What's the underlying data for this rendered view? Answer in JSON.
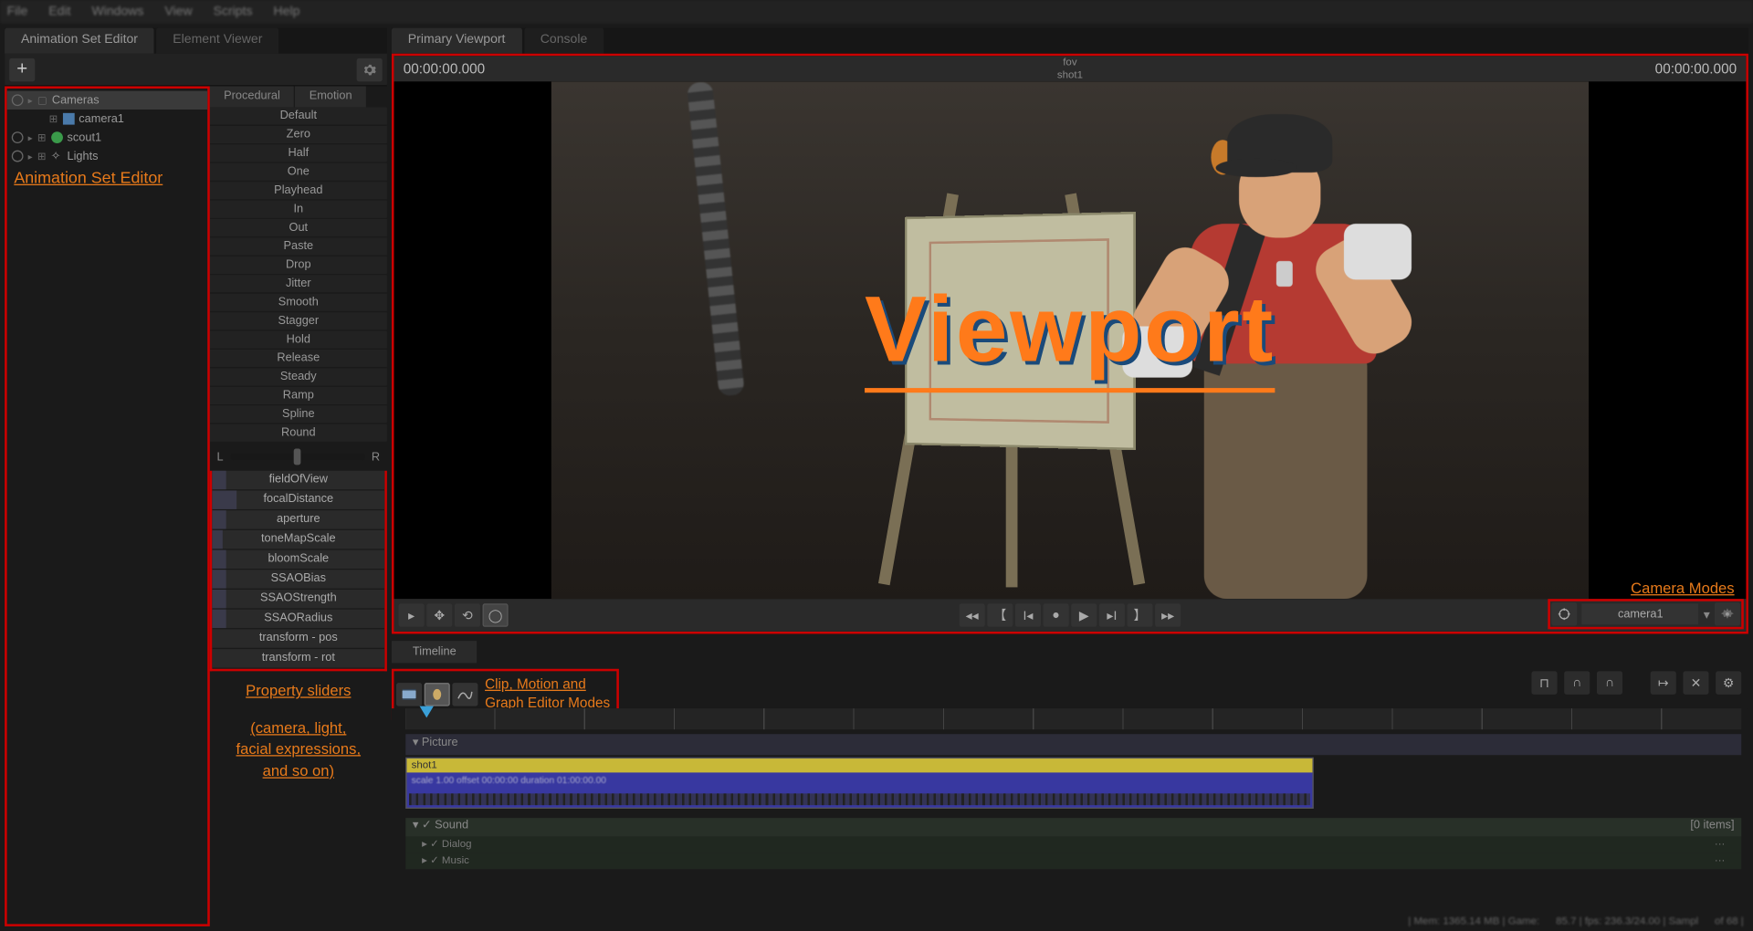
{
  "menu": [
    "File",
    "Edit",
    "Windows",
    "View",
    "Scripts",
    "Help"
  ],
  "leftTabs": {
    "a": "Animation Set Editor",
    "b": "Element Viewer"
  },
  "tree": {
    "cameras": "Cameras",
    "camera1": "camera1",
    "scout1": "scout1",
    "lights": "Lights"
  },
  "annotations": {
    "animset": "Animation Set Editor",
    "propsliders": "Property sliders",
    "propsliders2": "(camera, light,\nfacial expressions,\nand so on)",
    "viewport": "Viewport",
    "cameramodes": "Camera Modes",
    "editormodes1": "Clip, Motion and",
    "editormodes2": "Graph Editor Modes"
  },
  "propTabs": {
    "a": "Procedural",
    "b": "Emotion"
  },
  "presets": [
    "Default",
    "Zero",
    "Half",
    "One",
    "Playhead",
    "In",
    "Out",
    "Paste",
    "Drop",
    "Jitter",
    "Smooth",
    "Stagger",
    "Hold",
    "Release",
    "Steady",
    "Ramp",
    "Spline",
    "Round"
  ],
  "lr": {
    "l": "L",
    "r": "R"
  },
  "sliders": [
    "fieldOfView",
    "focalDistance",
    "aperture",
    "toneMapScale",
    "bloomScale",
    "SSAOBias",
    "SSAOStrength",
    "SSAORadius",
    "transform - pos",
    "transform - rot"
  ],
  "mainTabs": {
    "a": "Primary Viewport",
    "b": "Console"
  },
  "viewport": {
    "tcLeft": "00:00:00.000",
    "tcRight": "00:00:00.000",
    "topA": "fov",
    "topB": "shot1",
    "cameraSel": "camera1"
  },
  "timelineTab": "Timeline",
  "tracks": {
    "picture": "Picture",
    "shotName": "shot1",
    "shotMeta": "scale 1.00  offset  00:00:00  duration  01:00:00.00",
    "sound": "Sound",
    "soundItems": "[0 items]",
    "dialog": "Dialog",
    "music": "Music"
  },
  "status": {
    "mem": "| Mem: 1365.14 MB | Game:",
    "fps": "85.7 | fps:  236.3/24.00 | Sampl",
    "end": "of 68 |"
  }
}
